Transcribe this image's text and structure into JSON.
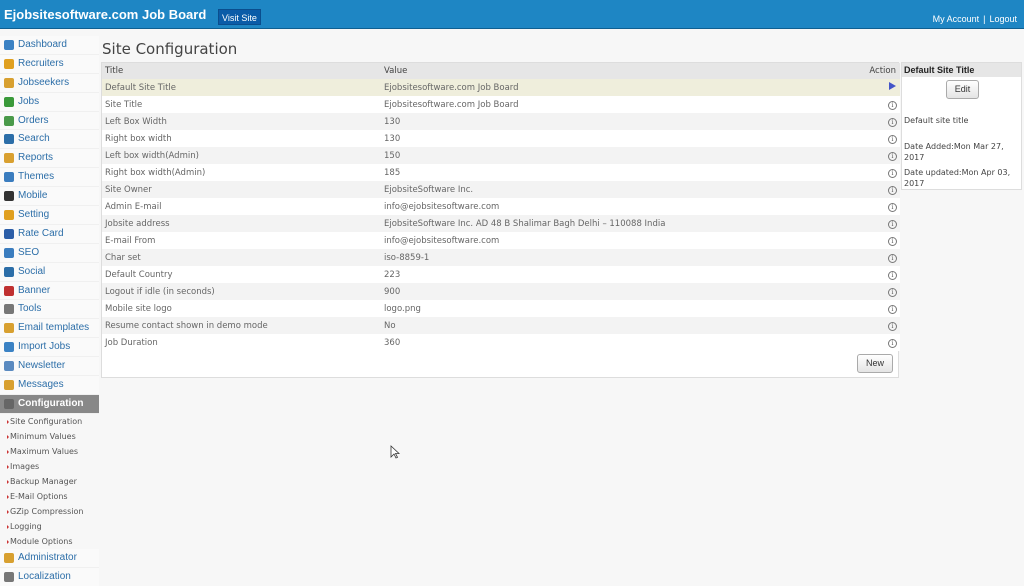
{
  "header": {
    "brand": "Ejobsitesoftware.com Job Board",
    "visit_site": "Visit Site",
    "my_account": "My Account",
    "separator": "|",
    "logout": "Logout"
  },
  "sidebar": {
    "items": [
      {
        "label": "Dashboard",
        "icon": "home-icon",
        "color": "#3b82c4"
      },
      {
        "label": "Recruiters",
        "icon": "user-icon",
        "color": "#e0a020"
      },
      {
        "label": "Jobseekers",
        "icon": "users-icon",
        "color": "#d8a030"
      },
      {
        "label": "Jobs",
        "icon": "briefcase-icon",
        "color": "#3a9a3a"
      },
      {
        "label": "Orders",
        "icon": "cart-icon",
        "color": "#4a9a4a"
      },
      {
        "label": "Search",
        "icon": "search-icon",
        "color": "#2c6ea8"
      },
      {
        "label": "Reports",
        "icon": "book-icon",
        "color": "#d9a030"
      },
      {
        "label": "Themes",
        "icon": "grid-icon",
        "color": "#3b7dbf"
      },
      {
        "label": "Mobile",
        "icon": "mobile-icon",
        "color": "#333333"
      },
      {
        "label": "Setting",
        "icon": "gear-icon",
        "color": "#e0a020"
      },
      {
        "label": "Rate Card",
        "icon": "dollar-icon",
        "color": "#2c5ea8"
      },
      {
        "label": "SEO",
        "icon": "bar-chart-icon",
        "color": "#3b7dbf"
      },
      {
        "label": "Social",
        "icon": "globe-icon",
        "color": "#2c6ea8"
      },
      {
        "label": "Banner",
        "icon": "palette-icon",
        "color": "#c03030"
      },
      {
        "label": "Tools",
        "icon": "tools-icon",
        "color": "#777777"
      },
      {
        "label": "Email templates",
        "icon": "mail-icon",
        "color": "#d8a030"
      },
      {
        "label": "Import Jobs",
        "icon": "download-icon",
        "color": "#3b82c4"
      },
      {
        "label": "Newsletter",
        "icon": "document-icon",
        "color": "#5a8ac0"
      },
      {
        "label": "Messages",
        "icon": "envelope-icon",
        "color": "#d8a030"
      },
      {
        "label": "Configuration",
        "icon": "config-icon",
        "color": "#666666",
        "active": true
      }
    ],
    "sub_items": [
      "Site Configuration",
      "Minimum Values",
      "Maximum Values",
      "Images",
      "Backup Manager",
      "E-Mail Options",
      "GZip Compression",
      "Logging",
      "Module Options"
    ],
    "bottom_items": [
      {
        "label": "Administrator",
        "icon": "lock-icon",
        "color": "#d8a030"
      },
      {
        "label": "Localization",
        "icon": "clock-icon",
        "color": "#777777"
      }
    ]
  },
  "main": {
    "title": "Site Configuration",
    "columns": {
      "title": "Title",
      "value": "Value",
      "action": "Action"
    },
    "rows": [
      {
        "title": "Default Site Title",
        "value": "Ejobsitesoftware.com Job Board",
        "selected": true
      },
      {
        "title": "Site Title",
        "value": "Ejobsitesoftware.com Job Board"
      },
      {
        "title": "Left Box Width",
        "value": "130"
      },
      {
        "title": "Right box width",
        "value": "130"
      },
      {
        "title": "Left box width(Admin)",
        "value": "150"
      },
      {
        "title": "Right box width(Admin)",
        "value": "185"
      },
      {
        "title": "Site Owner",
        "value": "EjobsiteSoftware Inc."
      },
      {
        "title": "Admin E-mail",
        "value": "info@ejobsitesoftware.com"
      },
      {
        "title": "Jobsite address",
        "value": "EjobsiteSoftware Inc. AD 48 B Shalimar Bagh Delhi – 110088 India"
      },
      {
        "title": "E-mail From",
        "value": "info@ejobsitesoftware.com"
      },
      {
        "title": "Char set",
        "value": "iso-8859-1"
      },
      {
        "title": "Default Country",
        "value": "223"
      },
      {
        "title": "Logout if idle (in seconds)",
        "value": "900"
      },
      {
        "title": "Mobile site logo",
        "value": "logo.png"
      },
      {
        "title": "Resume contact shown in demo mode",
        "value": "No"
      },
      {
        "title": "Job Duration",
        "value": "360"
      }
    ],
    "info_glyph": "i",
    "new_button": "New"
  },
  "panel": {
    "heading": "Default Site Title",
    "edit_button": "Edit",
    "description": "Default site title",
    "date_added": "Date Added:Mon Mar 27, 2017",
    "date_updated": "Date updated:Mon Apr 03, 2017"
  }
}
